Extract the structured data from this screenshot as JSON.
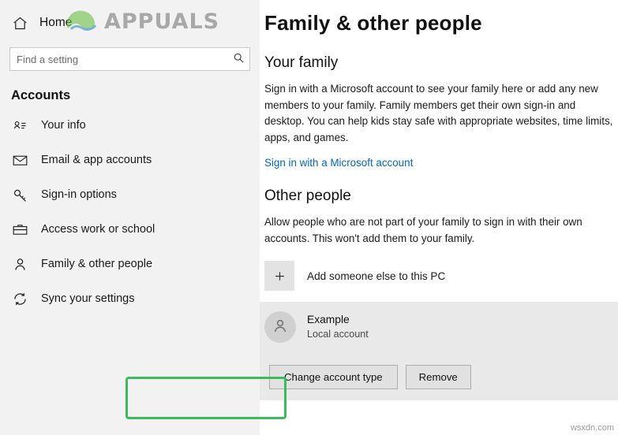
{
  "sidebar": {
    "home_label": "Home",
    "home_icon": "home-icon",
    "search": {
      "placeholder": "Find a setting",
      "value": "",
      "icon": "search-icon"
    },
    "section_title": "Accounts",
    "items": [
      {
        "label": "Your info",
        "icon": "user-card-icon"
      },
      {
        "label": "Email & app accounts",
        "icon": "envelope-icon"
      },
      {
        "label": "Sign-in options",
        "icon": "key-icon"
      },
      {
        "label": "Access work or school",
        "icon": "briefcase-icon"
      },
      {
        "label": "Family & other people",
        "icon": "person-icon"
      },
      {
        "label": "Sync your settings",
        "icon": "sync-icon"
      }
    ]
  },
  "main": {
    "page_title": "Family & other people",
    "family": {
      "heading": "Your family",
      "body": "Sign in with a Microsoft account to see your family here or add any new members to your family. Family members get their own sign-in and desktop. You can help kids stay safe with appropriate websites, time limits, apps, and games.",
      "link": "Sign in with a Microsoft account"
    },
    "other_people": {
      "heading": "Other people",
      "body": "Allow people who are not part of your family to sign in with their own accounts. This won't add them to your family.",
      "add_label": "Add someone else to this PC",
      "add_icon": "plus-icon",
      "account": {
        "name": "Example",
        "type": "Local account",
        "avatar_icon": "avatar-person-icon"
      },
      "buttons": {
        "change_type": "Change account type",
        "remove": "Remove"
      }
    }
  },
  "annotations": {
    "highlight_color": "#3dbb5c",
    "highlight_target": "Change account type"
  },
  "watermarks": {
    "brand": "APPUALS",
    "corner": "wsxdn.com"
  }
}
